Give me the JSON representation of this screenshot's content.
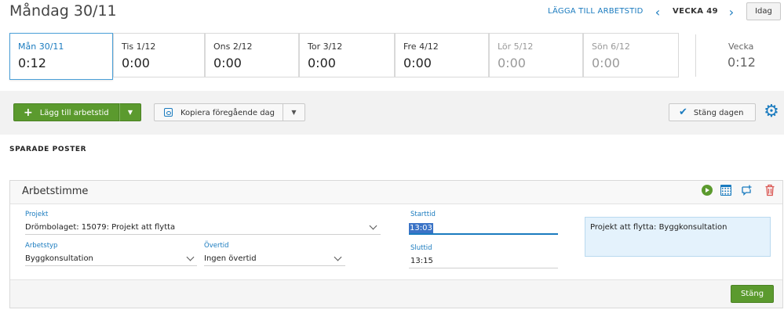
{
  "header": {
    "title": "Måndag 30/11",
    "add_worktime_link": "LÄGGA TILL ARBETSTID",
    "week_label": "VECKA 49",
    "today_button": "Idag"
  },
  "days": [
    {
      "name": "Mån 30/11",
      "time": "0:12"
    },
    {
      "name": "Tis 1/12",
      "time": "0:00"
    },
    {
      "name": "Ons 2/12",
      "time": "0:00"
    },
    {
      "name": "Tor 3/12",
      "time": "0:00"
    },
    {
      "name": "Fre 4/12",
      "time": "0:00"
    },
    {
      "name": "Lör 5/12",
      "time": "0:00"
    },
    {
      "name": "Sön 6/12",
      "time": "0:00"
    }
  ],
  "week_total": {
    "label": "Vecka",
    "value": "0:12"
  },
  "toolbar": {
    "add_worktime_button": "Lägg till arbetstid",
    "copy_prev_day_button": "Kopiera föregående dag",
    "close_day_button": "Stäng dagen"
  },
  "saved_heading": "SPARADE POSTER",
  "entry": {
    "title": "Arbetstimme",
    "project_label": "Projekt",
    "project_value": "Drömbolaget: 15079: Projekt att flytta",
    "worktype_label": "Arbetstyp",
    "worktype_value": "Byggkonsultation",
    "overtime_label": "Övertid",
    "overtime_value": "Ingen övertid",
    "start_label": "Starttid",
    "start_value": "13:03",
    "end_label": "Sluttid",
    "end_value": "13:15",
    "description": "Projekt att flytta: Byggkonsultation",
    "close_button": "Stäng"
  },
  "colors": {
    "accent": "#1a7bbf",
    "primary_green": "#5b9a2e",
    "delete_red": "#d9534f"
  }
}
